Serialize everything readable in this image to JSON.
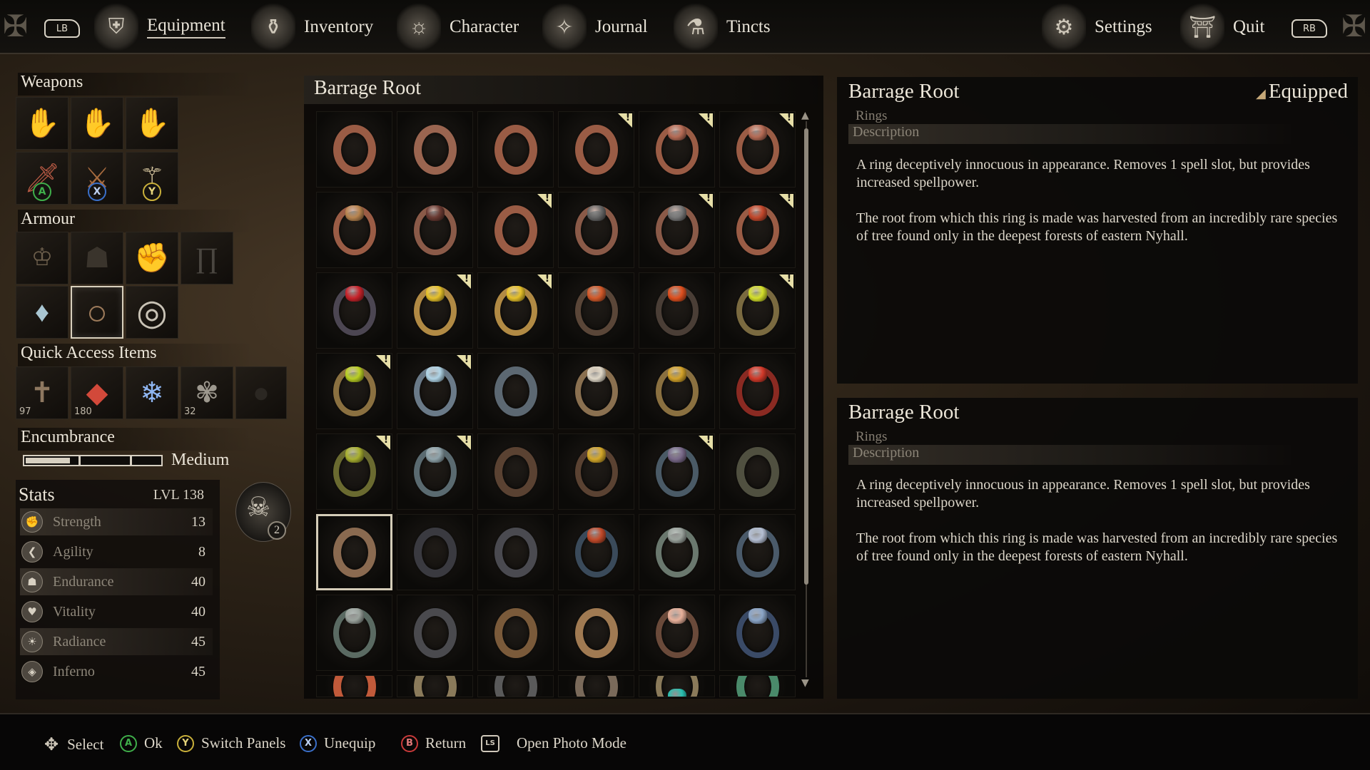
{
  "nav": {
    "lb": "LB",
    "rb": "RB",
    "tabs": [
      {
        "label": "Equipment",
        "icon": "equipment-icon",
        "active": true
      },
      {
        "label": "Inventory",
        "icon": "inventory-icon"
      },
      {
        "label": "Character",
        "icon": "character-icon"
      },
      {
        "label": "Journal",
        "icon": "journal-icon"
      },
      {
        "label": "Tincts",
        "icon": "tincts-icon"
      }
    ],
    "settings": "Settings",
    "quit": "Quit"
  },
  "left": {
    "weapons_title": "Weapons",
    "armour_title": "Armour",
    "quick_title": "Quick Access Items",
    "quick_qty": [
      "97",
      "180",
      "",
      "32",
      ""
    ],
    "weapon_buttons": [
      "A",
      "X",
      "Y"
    ],
    "encumbrance_title": "Encumbrance",
    "encumbrance_level": "Medium",
    "encumbrance_fill": 0.33,
    "stats_title": "Stats",
    "level": "LVL 138",
    "level_badge": "2",
    "stats": [
      {
        "name": "Strength",
        "value": "13"
      },
      {
        "name": "Agility",
        "value": "8"
      },
      {
        "name": "Endurance",
        "value": "40"
      },
      {
        "name": "Vitality",
        "value": "40"
      },
      {
        "name": "Radiance",
        "value": "45"
      },
      {
        "name": "Inferno",
        "value": "45"
      }
    ]
  },
  "grid": {
    "title": "Barrage Root",
    "new_mark": "!"
  },
  "detail_equipped": {
    "title": "Barrage Root",
    "tag": "Equipped",
    "category": "Rings",
    "desc_label": "Description",
    "p1": "A ring deceptively innocuous in appearance. Removes 1 spell slot, but provides increased spellpower.",
    "p2": "The root from which this ring is made was harvested from an incredibly rare species of tree found only in the deepest forests of eastern Nyhall."
  },
  "detail_selected": {
    "title": "Barrage Root",
    "category": "Rings",
    "desc_label": "Description",
    "p1": "A ring deceptively innocuous in appearance. Removes 1 spell slot, but provides increased spellpower.",
    "p2": "The root from which this ring is made was harvested from an incredibly rare species of tree found only in the deepest forests of eastern Nyhall."
  },
  "hints": [
    {
      "button": "✥",
      "label": "Select"
    },
    {
      "button": "A",
      "label": "Ok",
      "color": "#3fae4a"
    },
    {
      "button": "Y",
      "label": "Switch Panels",
      "color": "#c9b03a"
    },
    {
      "button": "X",
      "label": "Unequip",
      "color": "#3a6fc9"
    },
    {
      "button": "B",
      "label": "Return",
      "color": "#c93a3a"
    },
    {
      "button": "LS",
      "label": "Open Photo Mode"
    }
  ]
}
